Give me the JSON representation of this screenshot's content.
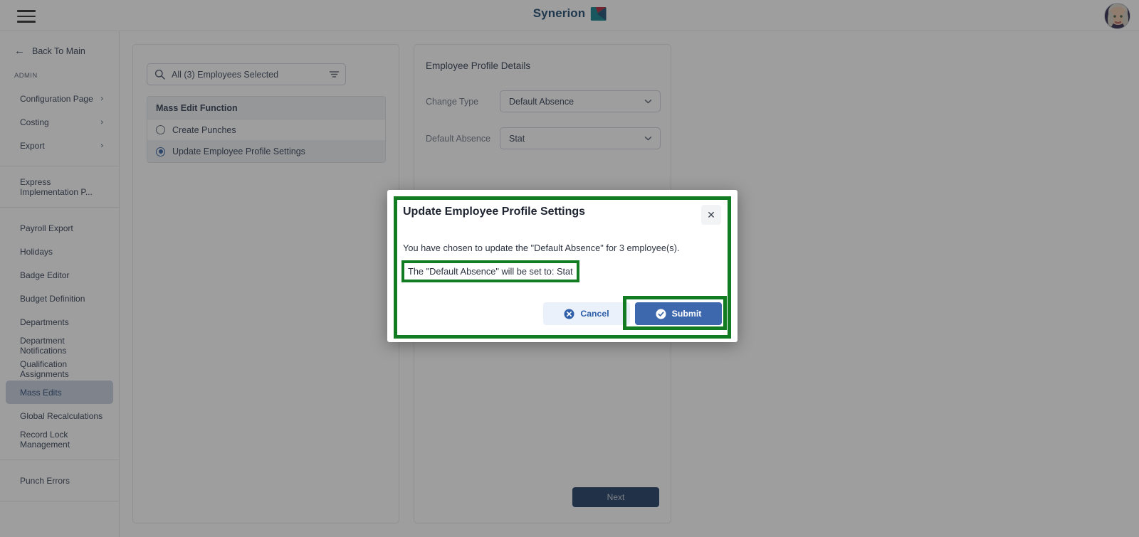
{
  "header": {
    "menu_icon": "hamburger-menu-icon",
    "brand_name": "Synerion",
    "brand_mark_icon": "synerion-logo-mark",
    "avatar_icon": "user-avatar",
    "brand_color": "#19466e"
  },
  "sidebar": {
    "back_label": "Back To Main",
    "back_icon": "arrow-left-icon",
    "section_label": "ADMIN",
    "group_one": [
      {
        "label": "Configuration Page",
        "chevron": "›"
      },
      {
        "label": "Costing",
        "chevron": "›"
      },
      {
        "label": "Export",
        "chevron": "›"
      }
    ],
    "group_two": [
      {
        "label": "Express Implementation P..."
      }
    ],
    "group_three": [
      {
        "label": "Payroll Export"
      },
      {
        "label": "Holidays"
      },
      {
        "label": "Badge Editor"
      },
      {
        "label": "Budget Definition"
      },
      {
        "label": "Departments"
      },
      {
        "label": "Department Notifications"
      },
      {
        "label": "Qualification Assignments"
      },
      {
        "label": "Mass Edits"
      },
      {
        "label": "Global Recalculations"
      },
      {
        "label": "Record Lock Management"
      }
    ],
    "group_four": [
      {
        "label": "Punch Errors"
      }
    ],
    "active_item": "Mass Edits",
    "scrollbar_color": "#2e5c8a"
  },
  "left_panel": {
    "search": {
      "value": "All (3) Employees Selected",
      "placeholder": "All (3) Employees Selected",
      "search_icon": "search-icon",
      "filter_icon": "filter-icon"
    },
    "mass_edit": {
      "header": "Mass Edit Function",
      "options": [
        {
          "label": "Create Punches",
          "selected": false
        },
        {
          "label": "Update Employee Profile Settings",
          "selected": true
        }
      ]
    }
  },
  "right_panel": {
    "title": "Employee Profile Details",
    "fields": [
      {
        "label": "Change Type",
        "value": "Default Absence"
      },
      {
        "label": "Default Absence",
        "value": "Stat"
      }
    ],
    "next_label": "Next",
    "next_color": "#1d3a63"
  },
  "modal": {
    "title": "Update Employee Profile Settings",
    "close_icon": "close-icon",
    "line1": "You have chosen to update the \"Default Absence\" for 3 employee(s).",
    "line2": "The \"Default Absence\" will be set to: Stat",
    "cancel_label": "Cancel",
    "cancel_icon": "cancel-circle-icon",
    "submit_label": "Submit",
    "submit_icon": "check-circle-icon",
    "cancel_color": "#eaf1fb",
    "submit_color": "#3d68ae"
  },
  "annotations": {
    "highlight_color": "#127c22",
    "targets": [
      "modal-dialog",
      "modal-line2",
      "submit-button"
    ]
  }
}
